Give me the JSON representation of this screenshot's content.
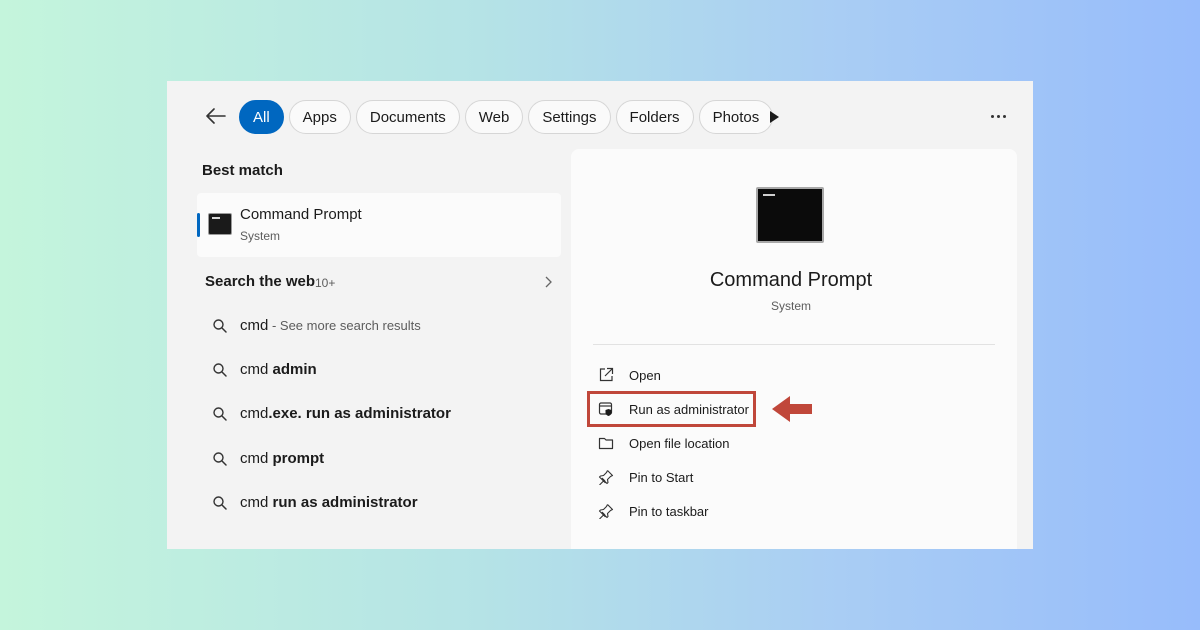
{
  "filters": {
    "tabs": [
      {
        "label": "All",
        "active": true
      },
      {
        "label": "Apps",
        "active": false
      },
      {
        "label": "Documents",
        "active": false
      },
      {
        "label": "Web",
        "active": false
      },
      {
        "label": "Settings",
        "active": false
      },
      {
        "label": "Folders",
        "active": false
      },
      {
        "label": "Photos",
        "active": false
      }
    ]
  },
  "left": {
    "best_match_title": "Best match",
    "best_match": {
      "name": "Command Prompt",
      "subtitle": "System",
      "icon": "command-prompt-icon"
    },
    "web_title": "Search the web",
    "web_count": "10+",
    "suggestions": [
      {
        "base": "cmd",
        "bold": "",
        "hint": " - See more search results"
      },
      {
        "base": "cmd ",
        "bold": "admin",
        "hint": ""
      },
      {
        "base": "cmd",
        "bold": ".exe. run as administrator",
        "hint": ""
      },
      {
        "base": "cmd ",
        "bold": "prompt",
        "hint": ""
      },
      {
        "base": "cmd ",
        "bold": "run as administrator",
        "hint": ""
      }
    ]
  },
  "right": {
    "title": "Command Prompt",
    "subtitle": "System",
    "actions": [
      {
        "label": "Open",
        "icon": "open-external-icon"
      },
      {
        "label": "Run as administrator",
        "icon": "shield-admin-icon",
        "highlighted": true
      },
      {
        "label": "Open file location",
        "icon": "folder-icon"
      },
      {
        "label": "Pin to Start",
        "icon": "pin-icon"
      },
      {
        "label": "Pin to taskbar",
        "icon": "pin-icon"
      }
    ]
  },
  "colors": {
    "accent": "#0067c0",
    "highlight": "#c0473a"
  }
}
